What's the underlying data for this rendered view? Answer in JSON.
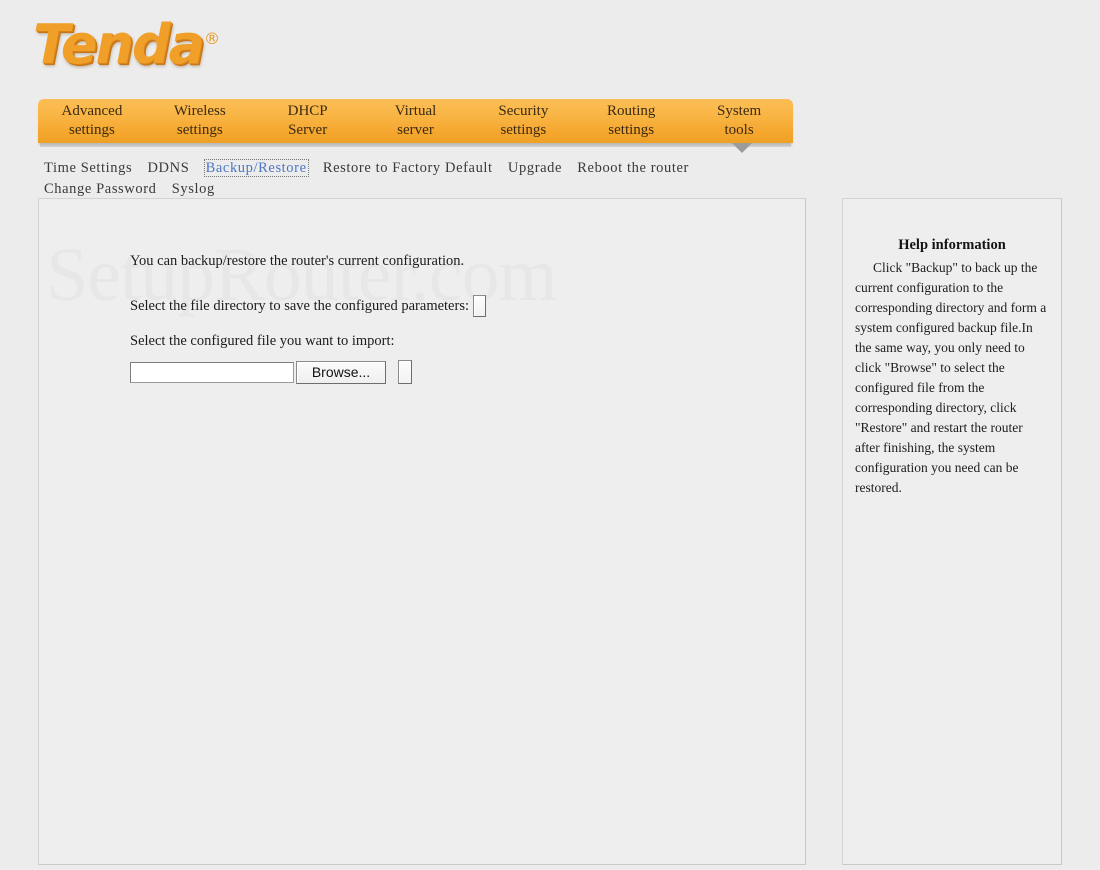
{
  "brand": {
    "name": "Tenda",
    "registered_mark": "®",
    "logo_color": "#f0a028"
  },
  "watermark": {
    "text": "SetupRouter.com"
  },
  "main_nav": {
    "active": "System tools",
    "items": [
      {
        "line1": "Advanced",
        "line2": "settings"
      },
      {
        "line1": "Wireless",
        "line2": "settings"
      },
      {
        "line1": "DHCP",
        "line2": "Server"
      },
      {
        "line1": "Virtual",
        "line2": "server"
      },
      {
        "line1": "Security",
        "line2": "settings"
      },
      {
        "line1": "Routing",
        "line2": "settings"
      },
      {
        "line1": "System",
        "line2": "tools"
      }
    ]
  },
  "sub_nav": {
    "active": "Backup/Restore",
    "items": [
      {
        "label": "Time Settings",
        "active": false
      },
      {
        "label": "DDNS",
        "active": false
      },
      {
        "label": "Backup/Restore",
        "active": true
      },
      {
        "label": "Restore to Factory Default",
        "active": false
      },
      {
        "label": "Upgrade",
        "active": false
      },
      {
        "label": "Reboot the router",
        "active": false
      },
      {
        "label": "Change Password",
        "active": false
      },
      {
        "label": "Syslog",
        "active": false
      }
    ]
  },
  "main": {
    "intro": "You can backup/restore the router's current configuration.",
    "backup_label": "Select the file directory to save the configured parameters:",
    "backup_button_label": "",
    "import_label": "Select the configured file you want to import:",
    "file_value": "",
    "file_placeholder": "",
    "browse_button_label": "Browse...",
    "restore_button_label": ""
  },
  "help": {
    "title": "Help information",
    "body": "Click \"Backup\" to back up the current configuration to the corresponding directory and form a system configured backup file.In the same way, you only need to click \"Browse\" to select the configured file from the corresponding directory, click \"Restore\" and restart the router after finishing, the system configuration you need can be restored."
  }
}
